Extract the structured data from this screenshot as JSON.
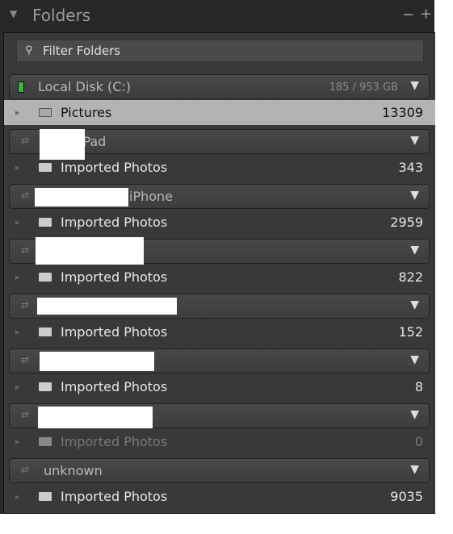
{
  "header": {
    "title": "Folders",
    "collapse_icon": "triangle-down-icon",
    "remove_label": "−",
    "add_label": "+"
  },
  "filter": {
    "placeholder": "Filter Folders",
    "icon": "search-icon"
  },
  "volumes": [
    {
      "name": "Local Disk (C:)",
      "size": "185 / 953 GB",
      "type": "disk",
      "folders": [
        {
          "name": "Pictures",
          "count": "13309",
          "selected": true
        }
      ]
    },
    {
      "name": "iPad",
      "type": "device",
      "redacted": true,
      "folders": [
        {
          "name": "Imported Photos",
          "count": "343"
        }
      ]
    },
    {
      "name": "iPhone",
      "type": "device",
      "redacted": true,
      "folders": [
        {
          "name": "Imported Photos",
          "count": "2959"
        }
      ]
    },
    {
      "name": "",
      "type": "device",
      "redacted": true,
      "folders": [
        {
          "name": "Imported Photos",
          "count": "822"
        }
      ]
    },
    {
      "name": "",
      "type": "device",
      "redacted": true,
      "folders": [
        {
          "name": "Imported Photos",
          "count": "152"
        }
      ]
    },
    {
      "name": "",
      "type": "device",
      "redacted": true,
      "folders": [
        {
          "name": "Imported Photos",
          "count": "8"
        }
      ]
    },
    {
      "name": "",
      "type": "device",
      "redacted": true,
      "folders": [
        {
          "name": "Imported Photos",
          "count": "0",
          "dim": true
        }
      ]
    },
    {
      "name": "unknown",
      "type": "device",
      "folders": [
        {
          "name": "Imported Photos",
          "count": "9035"
        }
      ]
    }
  ],
  "colors": {
    "disk_indicator": "#3db33d",
    "selected_row": "#b3b3b3"
  }
}
